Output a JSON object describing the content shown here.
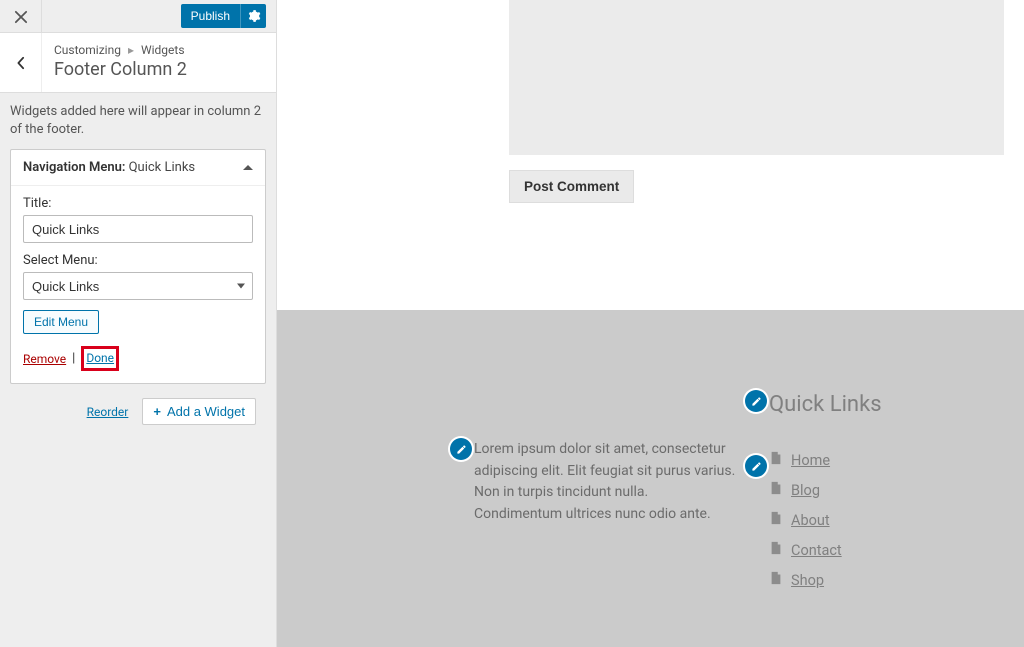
{
  "top": {
    "publish_label": "Publish"
  },
  "breadcrumb": {
    "root": "Customizing",
    "parent": "Widgets"
  },
  "section": {
    "title": "Footer Column 2",
    "description": "Widgets added here will appear in column 2 of the footer."
  },
  "widget": {
    "type_label": "Navigation Menu:",
    "name": "Quick Links",
    "title_label": "Title:",
    "title_value": "Quick Links",
    "select_label": "Select Menu:",
    "select_value": "Quick Links",
    "edit_menu_label": "Edit Menu",
    "remove_label": "Remove",
    "done_label": "Done"
  },
  "panel_footer": {
    "reorder_label": "Reorder",
    "add_widget_label": "Add a Widget"
  },
  "preview": {
    "post_comment_label": "Post Comment",
    "lorem": "Lorem ipsum dolor sit amet, consectetur adipiscing elit. Elit feugiat sit purus varius. Non in turpis tincidunt nulla. Condimentum ultrices nunc odio ante.",
    "quick_links_title": "Quick Links",
    "links": [
      {
        "label": "Home"
      },
      {
        "label": "Blog"
      },
      {
        "label": "About"
      },
      {
        "label": "Contact"
      },
      {
        "label": "Shop"
      }
    ]
  }
}
